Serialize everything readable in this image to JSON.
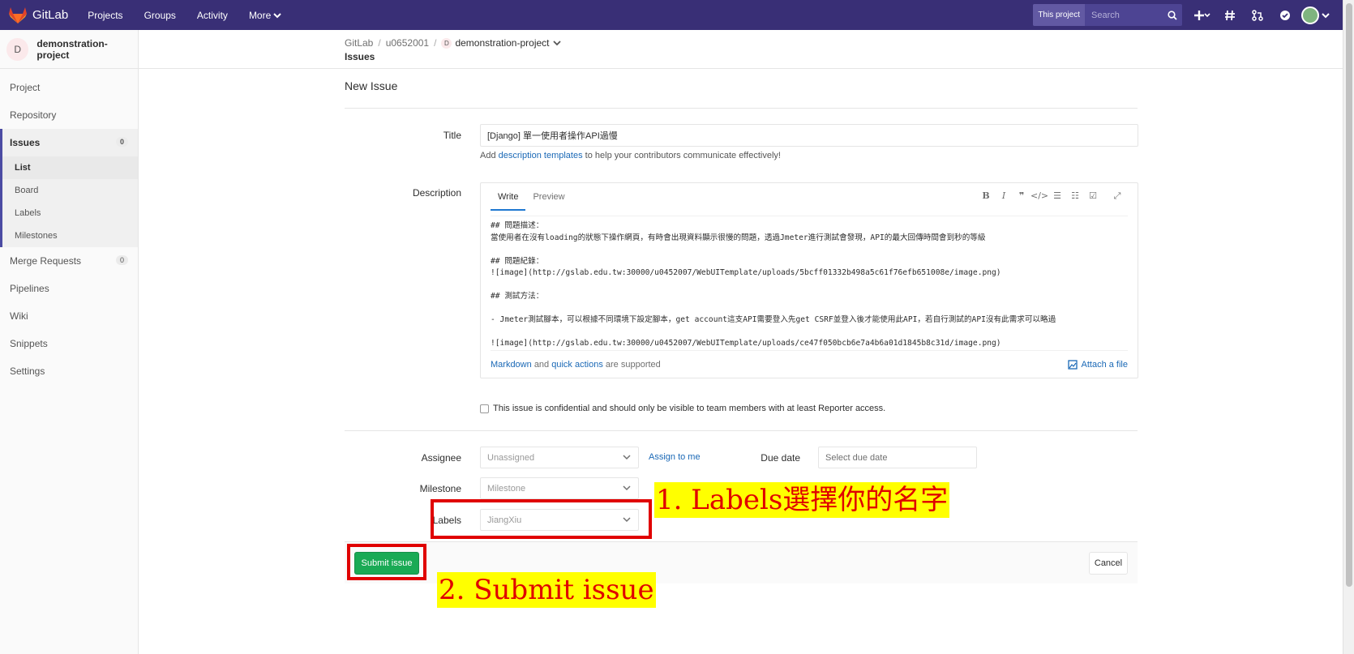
{
  "navbar": {
    "brand": "GitLab",
    "links": [
      "Projects",
      "Groups",
      "Activity",
      "More"
    ],
    "search_scope": "This project",
    "search_placeholder": "Search"
  },
  "sidebar": {
    "project_initial": "D",
    "project_name": "demonstration-project",
    "items": [
      {
        "label": "Project"
      },
      {
        "label": "Repository"
      },
      {
        "label": "Issues",
        "count": "0"
      },
      {
        "label": "Merge Requests",
        "count": "0"
      },
      {
        "label": "Pipelines"
      },
      {
        "label": "Wiki"
      },
      {
        "label": "Snippets"
      },
      {
        "label": "Settings"
      }
    ],
    "issues_sub": [
      "List",
      "Board",
      "Labels",
      "Milestones"
    ]
  },
  "breadcrumb": {
    "root": "GitLab",
    "user": "u0652001",
    "project_initial": "D",
    "project": "demonstration-project",
    "page": "Issues"
  },
  "form": {
    "heading": "New Issue",
    "title_label": "Title",
    "title_value": "[Django] 單一使用者操作API過慢",
    "help_prefix": "Add",
    "help_link": "description templates",
    "help_suffix": "to help your contributors communicate effectively!",
    "description_label": "Description",
    "tab_write": "Write",
    "tab_preview": "Preview",
    "description_text": "## 問題描述：\n當使用者在沒有loading的狀態下操作網頁，有時會出現資料顯示很慢的問題，透過Jmeter進行測試會發現，API的最大回傳時間會到秒的等級\n\n## 問題紀錄：\n![image](http://gslab.edu.tw:30000/u0452007/WebUITemplate/uploads/5bcff01332b498a5c61f76efb651008e/image.png)\n\n## 測試方法：\n\n- Jmeter測試腳本，可以根據不同環境下設定腳本，get account這支API需要登入先get CSRF並登入後才能使用此API，若自行測試的API沒有此需求可以略過\n\n![image](http://gslab.edu.tw:30000/u0452007/WebUITemplate/uploads/ce47f050bcb6e7a4b6a01d1845b8c31d/image.png)",
    "foot_markdown": "Markdown",
    "foot_and": "and",
    "foot_quick": "quick actions",
    "foot_supported": "are supported",
    "attach": "Attach a file",
    "confidential": "This issue is confidential and should only be visible to team members with at least Reporter access.",
    "assignee_label": "Assignee",
    "assignee_value": "Unassigned",
    "assign_to_me": "Assign to me",
    "due_label": "Due date",
    "due_placeholder": "Select due date",
    "milestone_label": "Milestone",
    "milestone_value": "Milestone",
    "labels_label": "Labels",
    "labels_value": "JiangXiu",
    "submit": "Submit issue",
    "cancel": "Cancel"
  },
  "annotations": {
    "step1": "1. Labels選擇你的名字",
    "step2": "2. Submit issue"
  }
}
